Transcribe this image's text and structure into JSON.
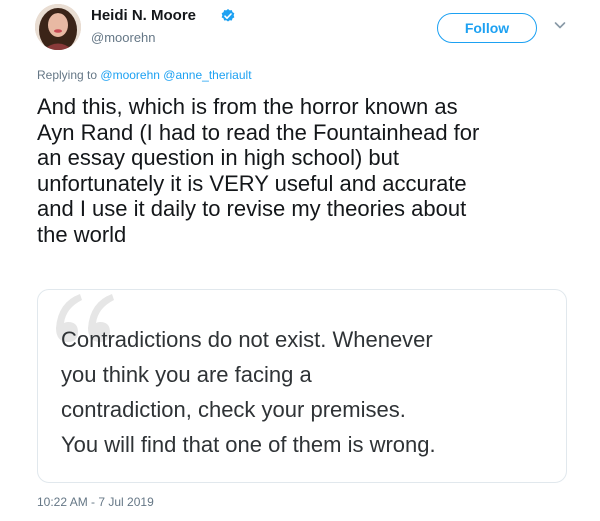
{
  "author": {
    "name": "Heidi N. Moore",
    "handle": "@moorehn",
    "avatar": "avatar-photo",
    "verified_icon": "verified-badge-icon"
  },
  "follow_button": {
    "label": "Follow"
  },
  "menu_icon": "chevron-down-icon",
  "reply": {
    "prefix": "Replying to",
    "mentions": [
      "@moorehn",
      "@anne_theriault"
    ]
  },
  "tweet_lines": [
    "And this, which is from the horror known as",
    "Ayn Rand (I had to read the Fountainhead for",
    "an essay question in high school) but",
    "unfortunately it is VERY useful and accurate",
    "and I use it daily to revise my theories about",
    "the world"
  ],
  "quote": {
    "icon": "quote-mark-icon",
    "lines": [
      "Contradictions do not exist. Whenever",
      "you think you are facing a",
      "contradiction, check your premises.",
      "You will find that one of them is wrong."
    ]
  },
  "timestamp": "10:22 AM - 7 Jul 2019",
  "colors": {
    "accent": "#1da1f2",
    "text": "#14171a",
    "muted": "#657786",
    "border": "#e1e8ed"
  }
}
